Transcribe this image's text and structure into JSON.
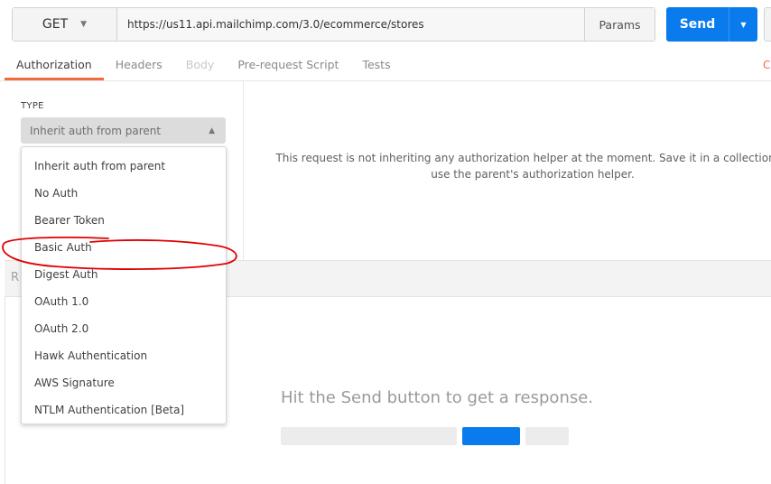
{
  "request": {
    "method": "GET",
    "url": "https://us11.api.mailchimp.com/3.0/ecommerce/stores",
    "params_label": "Params",
    "send_label": "Send"
  },
  "tabs": [
    {
      "label": "Authorization",
      "state": "active"
    },
    {
      "label": "Headers",
      "state": "normal"
    },
    {
      "label": "Body",
      "state": "disabled"
    },
    {
      "label": "Pre-request Script",
      "state": "normal"
    },
    {
      "label": "Tests",
      "state": "normal"
    }
  ],
  "right_edge_text": "C",
  "auth": {
    "type_label": "TYPE",
    "selected": "Inherit auth from parent",
    "message": "This request is not inheriting any authorization helper at the moment. Save it in a collection to use the parent's authorization helper.",
    "options": [
      "Inherit auth from parent",
      "No Auth",
      "Bearer Token",
      "Basic Auth",
      "Digest Auth",
      "OAuth 1.0",
      "OAuth 2.0",
      "Hawk Authentication",
      "AWS Signature",
      "NTLM Authentication [Beta]"
    ]
  },
  "response": {
    "section_letter": "R",
    "hint": "Hit the Send button to get a response."
  },
  "colors": {
    "accent": "#097bed",
    "active_tab": "#f26b3a",
    "annotation": "#e00000"
  },
  "icons": {
    "method_caret": "chevron-down-icon",
    "send_caret": "chevron-down-icon",
    "select_caret": "chevron-up-icon"
  }
}
